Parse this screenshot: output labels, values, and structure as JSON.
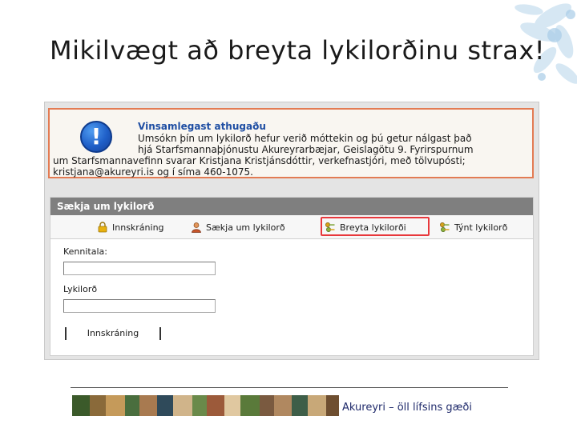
{
  "slide": {
    "title": "Mikilvægt að breyta lykilorðinu strax!",
    "footer_text": "Akureyri – öll lífsins gæði"
  },
  "notice": {
    "icon": "info-exclamation-icon",
    "title": "Vinsamlegast athugaðu",
    "lines": [
      "Umsókn þín um lykilorð hefur verið móttekin og þú getur nálgast það",
      "hjá Starfsmannaþjónustu Akureyrarbæjar, Geislagötu 9. Fyrirspurnum",
      "um Starfsmannavefinn svarar Kristjana Kristjánsdóttir, verkefnastjóri, með tölvupósti;",
      "kristjana@akureyri.is og í síma 460-1075."
    ],
    "border_color": "#e37b53"
  },
  "form": {
    "header": "Sækja um lykilorð",
    "tabs": [
      {
        "label": "Innskráning",
        "icon": "lock-icon"
      },
      {
        "label": "Sækja um lykilorð",
        "icon": "user-icon"
      },
      {
        "label": "Breyta lykilorði",
        "icon": "keys-icon"
      },
      {
        "label": "Týnt lykilorð",
        "icon": "keys-icon"
      }
    ],
    "highlighted_tab": "Breyta lykilorði",
    "highlight_color": "#e8383c",
    "fields": [
      {
        "label": "Kennitala:",
        "value": ""
      },
      {
        "label": "Lykilorð",
        "value": ""
      }
    ],
    "submit_label": "Innskráning"
  }
}
